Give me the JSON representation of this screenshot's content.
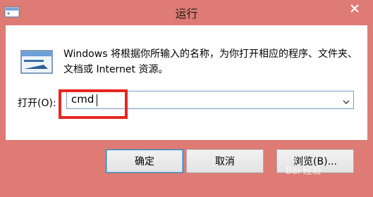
{
  "window": {
    "title": "运行",
    "close_icon": "close-icon",
    "app_icon": "run-app-icon"
  },
  "main": {
    "description": "Windows 将根据你所输入的名称，为你打开相应的程序、文件夹、文档或 Internet 资源。",
    "open_label": "打开(O):",
    "open_value": "cmd"
  },
  "buttons": {
    "ok": "确定",
    "cancel": "取消",
    "browse": "浏览(B)..."
  },
  "overlay": {
    "highlight_color": "#e8261f",
    "watermark": "Bai 经验"
  },
  "colors": {
    "frame": "#dd7b74",
    "panel": "#ffffff",
    "focus_border": "#3c7fb1"
  }
}
